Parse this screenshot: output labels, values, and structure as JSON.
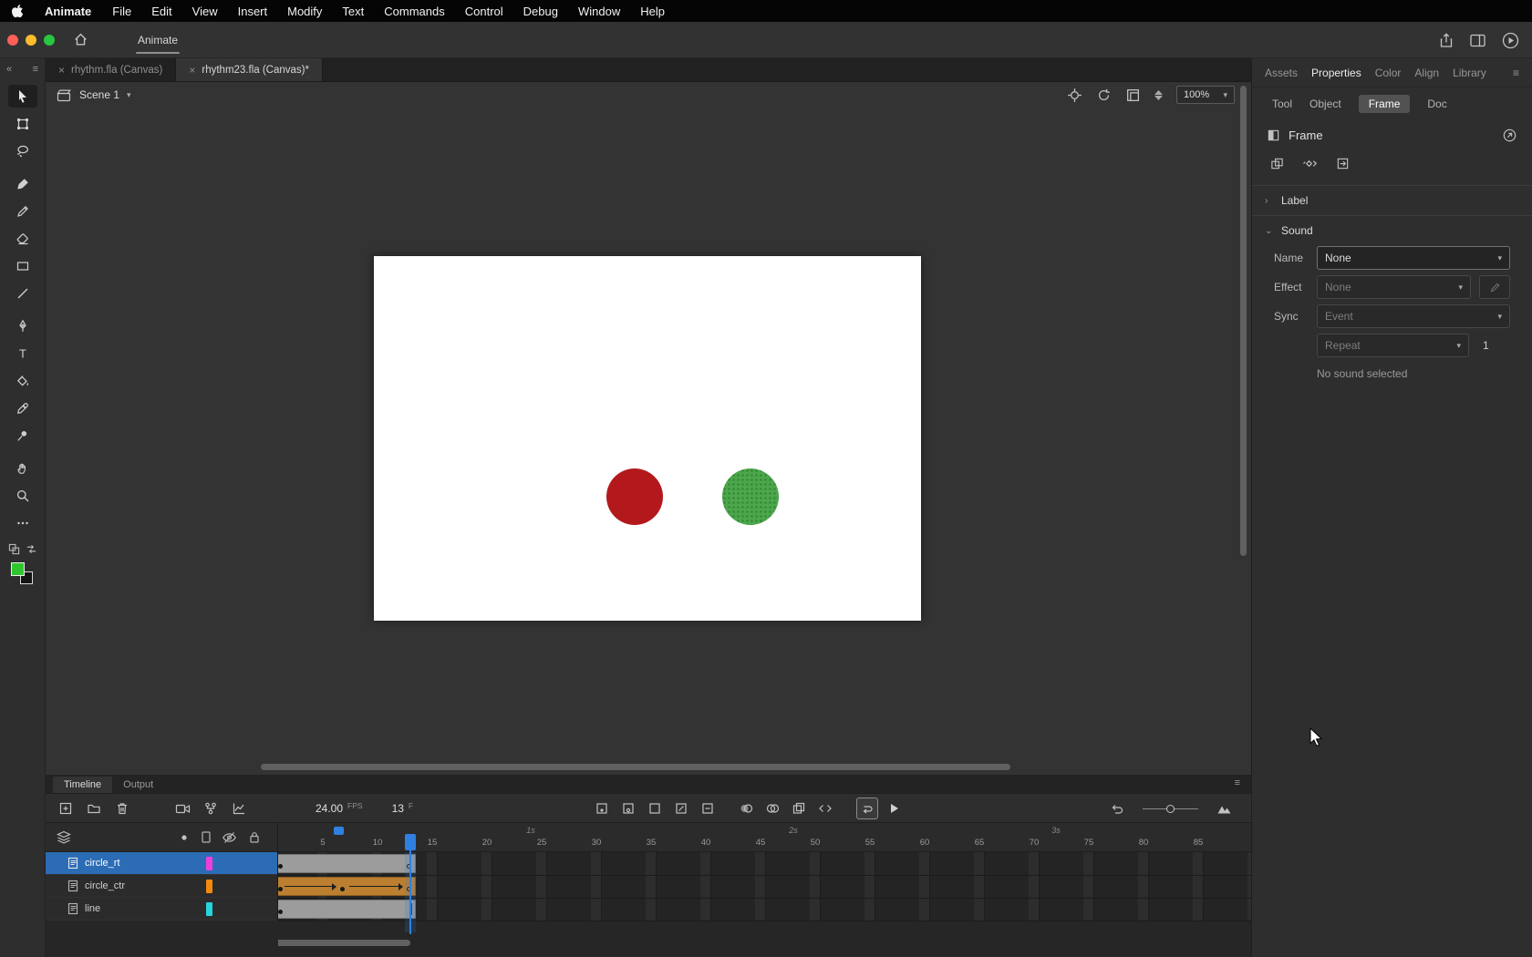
{
  "menubar": {
    "app_name": "Animate",
    "items": [
      "File",
      "Edit",
      "View",
      "Insert",
      "Modify",
      "Text",
      "Commands",
      "Control",
      "Debug",
      "Window",
      "Help"
    ]
  },
  "titlebar": {
    "workspace_tab": "Animate"
  },
  "doc_tabs": {
    "tab1": "rhythm.fla (Canvas)",
    "tab2": "rhythm23.fla (Canvas)*"
  },
  "toolbar": {
    "tools": [
      "selection",
      "free-transform",
      "lasso",
      "brush",
      "pencil",
      "eraser",
      "rectangle",
      "line",
      "pen",
      "text",
      "paint-bucket",
      "eyedropper",
      "pin",
      "hand",
      "zoom",
      "more",
      "swap-colors",
      "fill-swatch"
    ],
    "active_tool": "selection",
    "fill_color": "#2ec52e"
  },
  "stage_bar": {
    "scene_label": "Scene 1",
    "zoom_value": "100%"
  },
  "stage": {
    "circle1_color": "#b3191c",
    "circle2_color": "#4ca64c"
  },
  "properties": {
    "tabs": [
      "Assets",
      "Properties",
      "Color",
      "Align",
      "Library"
    ],
    "active_tab": "Properties",
    "subtabs": [
      "Tool",
      "Object",
      "Frame",
      "Doc"
    ],
    "active_subtab": "Frame",
    "panel_title": "Frame",
    "sections": {
      "label": "Label",
      "sound": "Sound"
    },
    "sound": {
      "name_label": "Name",
      "name_value": "None",
      "effect_label": "Effect",
      "effect_value": "None",
      "sync_label": "Sync",
      "sync_value": "Event",
      "repeat_value": "Repeat",
      "repeat_count": "1",
      "status": "No sound selected"
    }
  },
  "timeline": {
    "tabs": [
      "Timeline",
      "Output"
    ],
    "active_tab": "Timeline",
    "fps_value": "24.00",
    "fps_unit": "FPS",
    "frame_value": "13",
    "frame_unit": "F",
    "ruler": [
      "5",
      "10",
      "15",
      "20",
      "25",
      "30",
      "35",
      "40",
      "45",
      "50",
      "55",
      "60",
      "65",
      "70",
      "75",
      "80",
      "85"
    ],
    "seconds": [
      "1s",
      "2s",
      "3s"
    ],
    "layers": [
      {
        "name": "circle_rt",
        "color": "#ef3fd8",
        "selected": true
      },
      {
        "name": "circle_ctr",
        "color": "#f28a0e",
        "selected": false
      },
      {
        "name": "line",
        "color": "#27d3df",
        "selected": false
      }
    ]
  }
}
